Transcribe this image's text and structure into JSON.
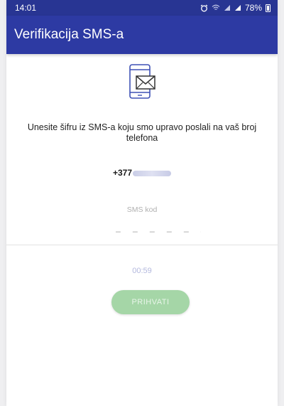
{
  "status_bar": {
    "time": "14:01",
    "battery": "78%",
    "icons": [
      "alarm-icon",
      "wifi-icon",
      "signal-icon",
      "signal-icon",
      "battery-icon"
    ]
  },
  "app_bar": {
    "title": "Verifikacija SMS-a",
    "background": "#2d3aa3"
  },
  "main": {
    "icon": "phone-envelope-icon",
    "instruction": "Unesite šifru iz SMS-a koju smo upravo poslali na vaš broj telefona",
    "phone_prefix": "+377",
    "code_label": "SMS kod",
    "code_placeholder": "_ _ _ _ _ _",
    "timer": "00:59",
    "accept_label": "PRIHVATI",
    "accept_color": "#a5d6a7"
  }
}
